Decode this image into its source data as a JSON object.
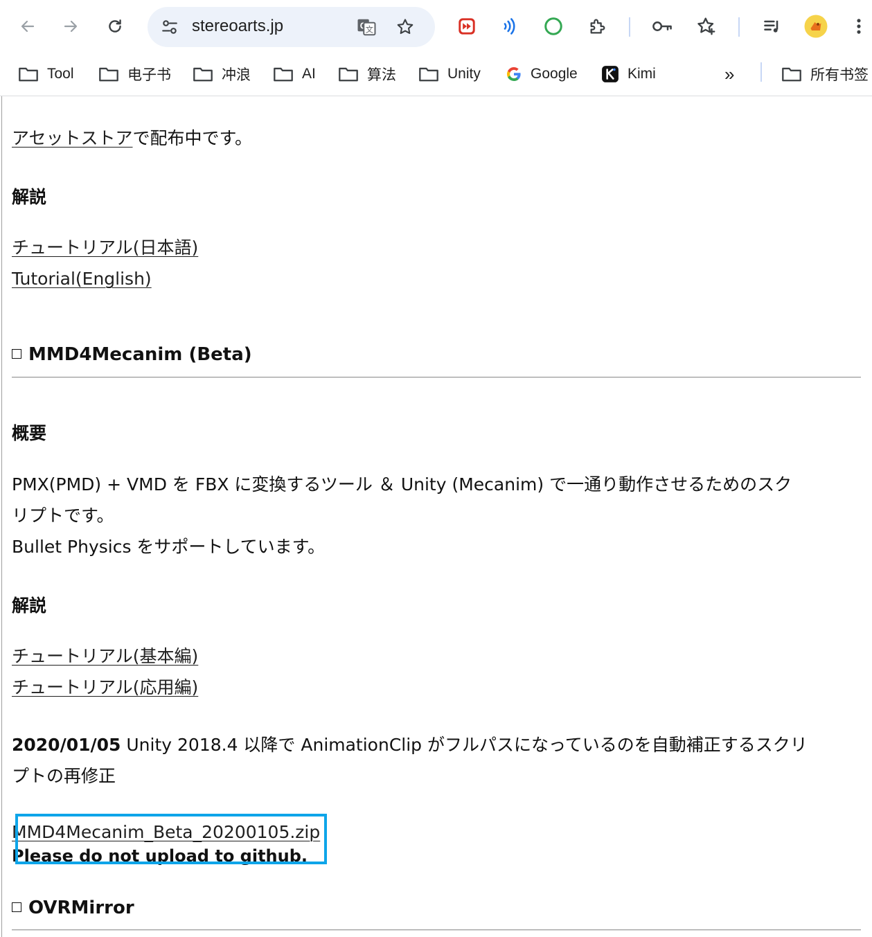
{
  "browser": {
    "url": "stereoarts.jp",
    "bookmarks": [
      {
        "label": "Tool",
        "icon": "folder-icon"
      },
      {
        "label": "电子书",
        "icon": "folder-icon"
      },
      {
        "label": "冲浪",
        "icon": "folder-icon"
      },
      {
        "label": "AI",
        "icon": "folder-icon"
      },
      {
        "label": "算法",
        "icon": "folder-icon"
      },
      {
        "label": "Unity",
        "icon": "folder-icon"
      },
      {
        "label": "Google",
        "icon": "google-icon"
      },
      {
        "label": "Kimi",
        "icon": "kimi-icon"
      }
    ],
    "all_bookmarks": "所有书签",
    "overflow": "»"
  },
  "page": {
    "intro_link": "アセットストア",
    "intro_rest": "で配布中です。",
    "section1_heading": "解説",
    "tutorial_links_1": [
      "チュートリアル(日本語)",
      "Tutorial(English)"
    ],
    "mmd_heading": "MMD4Mecanim (Beta)",
    "overview_heading": "概要",
    "overview_line1": "PMX(PMD) + VMD を FBX に変換するツール ＆ Unity (Mecanim) で一通り動作させるためのスク",
    "overview_line2": "リプトです。",
    "overview_line3": "Bullet Physics をサポートしています。",
    "section2_heading": "解説",
    "tutorial_links_2": [
      "チュートリアル(基本編)",
      "チュートリアル(応用編)"
    ],
    "update_date": "2020/01/05",
    "update_text_line1": " Unity 2018.4 以降で AnimationClip がフルパスになっているのを自動補正するスクリ",
    "update_text_line2": "プトの再修正",
    "download_link": "MMD4Mecanim_Beta_20200105.zip",
    "warning": "Please do not upload to github.",
    "next_heading": "OVRMirror"
  },
  "colors": {
    "highlight": "#0ea5e9",
    "omnibox_bg": "#edf2fa"
  }
}
